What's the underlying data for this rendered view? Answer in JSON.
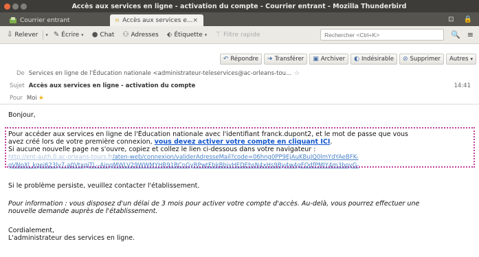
{
  "window": {
    "title": "Accès aux services en ligne - activation du compte - Courrier entrant - Mozilla Thunderbird"
  },
  "tabs": [
    {
      "label": "Courrier entrant",
      "active": false
    },
    {
      "label": "Accès aux services e...",
      "active": true,
      "close": "×"
    }
  ],
  "toolbar": {
    "relever": "Relever",
    "ecrire": "Écrire",
    "chat": "Chat",
    "adresses": "Adresses",
    "etiquette": "Étiquette",
    "filtre": "Filtre rapide",
    "search_placeholder": "Rechercher <Ctrl+K>"
  },
  "actions": {
    "repondre": "Répondre",
    "transferer": "Transférer",
    "archiver": "Archiver",
    "indesirable": "Indésirable",
    "supprimer": "Supprimer",
    "autres": "Autres"
  },
  "header": {
    "from_label": "De",
    "from_value": "Services en ligne de l'Éducation nationale <administrateur-teleservices@ac-orleans-tou...",
    "subject_label": "Sujet",
    "subject_value": "Accès aux services en ligne - activation du compte",
    "time": "14:41",
    "to_label": "Pour",
    "to_value": "Moi"
  },
  "message": {
    "greeting": "Bonjour,",
    "p1_a": "Pour accéder aux services en ligne de l'Éducation nationale avec l'identifiant franck.dupont2, et le mot de passe que vous",
    "p1_b": "avez créé lors de votre première connexion,",
    "p1_link": "vous devez activer votre compte en cliquant ICI",
    "p1_end": ".",
    "p2": "Si aucune nouvelle page ne s'ouvre, copiez et collez le lien ci-dessous dans votre navigateur :",
    "url1_blur": "http://ent-auth.0.ac-orleans-tours.fr",
    "url1_clear": "/aten-web/connexion/validerAdresseMail?code=06hng0PP9EjAuKBuJQ0lmYdYAeBFK-",
    "url2": "gVNoXl_kqei623ly7-a0VtxgjTL--AingMWLV29WWMYHR91BCnGyRPwtEbkBbivHEDEhsN4xHs9By4w4gFQdfPMIY4m3boyG-",
    "p3": "Si le problème persiste, veuillez contacter l'établissement.",
    "p4_a": "Pour information : vous disposez d'un délai de 3 mois pour activer votre compte d'accès. Au-delà, vous pourrez effectuer une",
    "p4_b": "nouvelle demande auprès de l'établissement.",
    "sign1": "Cordialement,",
    "sign2": "L'administrateur des services en ligne."
  },
  "colors": {
    "titlebar": "#3d3c38",
    "close_button": "#ea6a3d",
    "link": "#1155cc",
    "highlight_border": "#c23d9a"
  }
}
